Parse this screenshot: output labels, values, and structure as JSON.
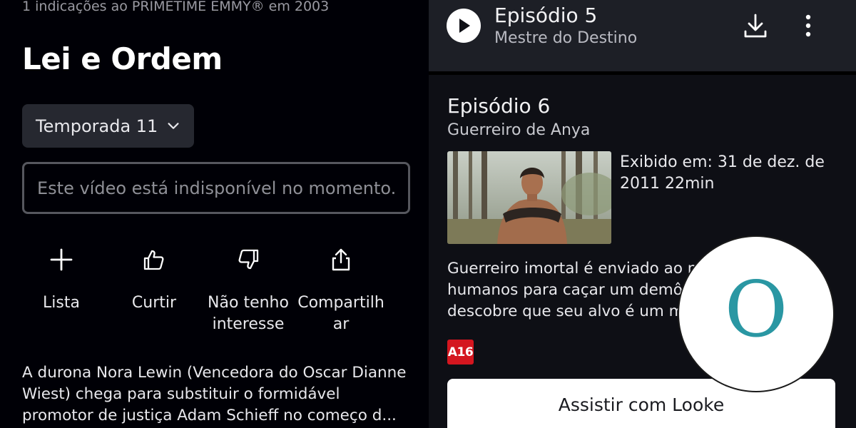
{
  "show": {
    "award_text": "1 indicações ao PRIMETIME EMMY® em 2003",
    "title": "Lei e Ordem",
    "season_selector": "Temporada 11",
    "unavailable_message": "Este vídeo está indisponível no momento.",
    "actions": [
      {
        "label": "Lista",
        "icon": "plus-icon"
      },
      {
        "label": "Curtir",
        "icon": "thumbs-up-icon"
      },
      {
        "label": "Não tenho interesse",
        "icon": "thumbs-down-icon"
      },
      {
        "label": "Compartilhar",
        "icon": "share-icon"
      }
    ],
    "description": "A durona Nora Lewin (Vencedora do Oscar Dianne Wiest) chega para substituir o formidável promotor de justiça Adam Schieff no começo d..."
  },
  "now_playing": {
    "episode_label": "Episódio 5",
    "episode_title": "Mestre do Destino",
    "icons": [
      "play-icon",
      "download-icon",
      "more-vertical-icon"
    ]
  },
  "episode": {
    "episode_label": "Episódio 6",
    "episode_title": "Guerreiro de Anya",
    "aired_info": "Exibido em: 31 de dez. de 2011 22min",
    "synopsis_lines": [
      "Guerreiro imortal é enviado ao m",
      "humanos para caçar um demô",
      "descobre que seu alvo é um m"
    ],
    "age_rating": "A16",
    "watch_button": "Assistir com Looke"
  },
  "logo": {
    "letter": "O"
  },
  "colors": {
    "background_left": "#000006",
    "background_right": "#0e0f15",
    "top_bar": "#1d1f26",
    "rating_red": "#d4161f",
    "logo_teal": "#2a97a3"
  }
}
